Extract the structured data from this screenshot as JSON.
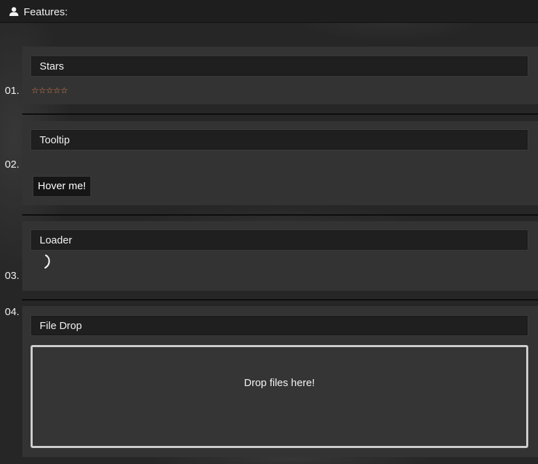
{
  "header": {
    "title": "Features:",
    "icon": "user-icon"
  },
  "sections": [
    {
      "num": "01.",
      "title": "Stars",
      "stars": {
        "rating": 0,
        "max": 5,
        "glyph": "☆",
        "color": "#e8844a"
      }
    },
    {
      "num": "02.",
      "title": "Tooltip",
      "button_label": "Hover me!"
    },
    {
      "num": "03.",
      "title": "Loader",
      "loader_icon": "spinner-icon"
    },
    {
      "num": "04.",
      "title": "File Drop",
      "drop_label": "Drop files here!"
    }
  ]
}
